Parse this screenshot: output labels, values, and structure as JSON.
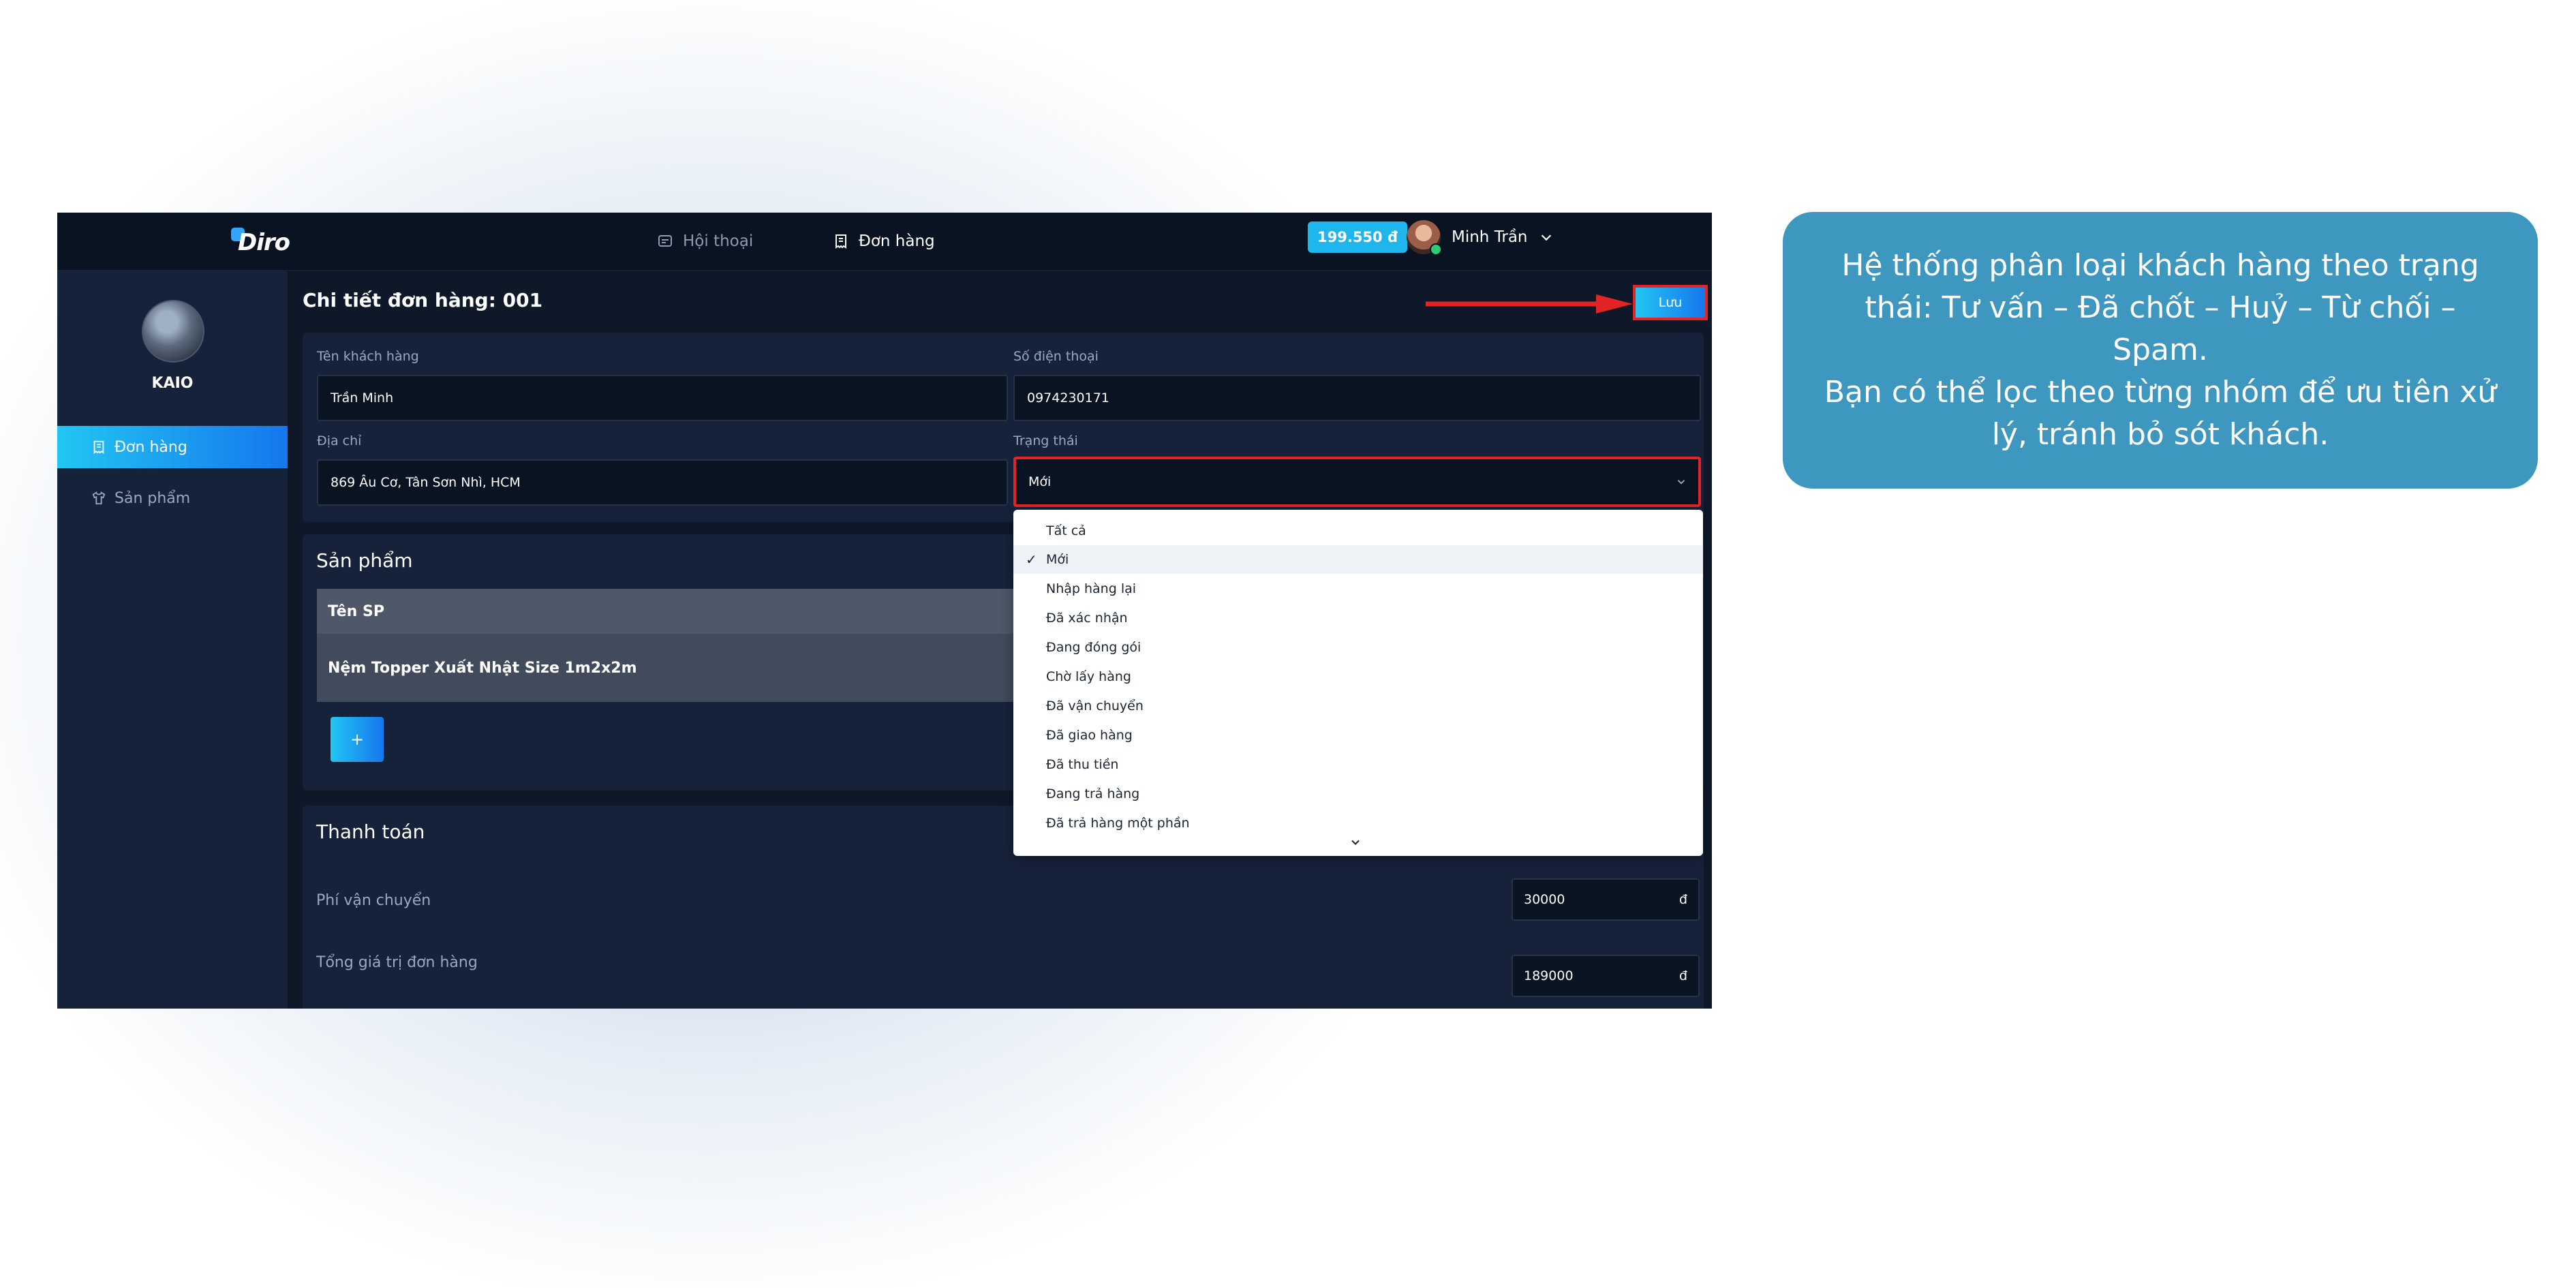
{
  "header": {
    "logo_text": "Diro",
    "nav": [
      {
        "label": "Hội thoại",
        "icon": "chat-icon"
      },
      {
        "label": "Đơn hàng",
        "icon": "receipt-icon"
      }
    ],
    "balance": "199.550 đ",
    "user_name": "Minh Trần"
  },
  "sidebar": {
    "shop_name": "KAIO",
    "items": [
      {
        "label": "Đơn hàng",
        "icon": "receipt-icon",
        "active": true
      },
      {
        "label": "Sản phẩm",
        "icon": "shirt-icon",
        "active": false
      }
    ]
  },
  "page": {
    "title": "Chi tiết đơn hàng: 001",
    "save_label": "Lưu"
  },
  "customer": {
    "name_label": "Tên khách hàng",
    "name_value": "Trần Minh",
    "phone_label": "Số điện thoại",
    "phone_value": "0974230171",
    "address_label": "Địa chỉ",
    "address_value": "869 Âu Cơ, Tân Sơn Nhì, HCM",
    "status_label": "Trạng thái",
    "status_value": "Mới"
  },
  "products": {
    "title": "Sản phẩm",
    "column_name": "Tên SP",
    "rows": [
      {
        "name": "Nệm Topper Xuất Nhật Size 1m2x2m"
      }
    ],
    "add_label": "+"
  },
  "payment": {
    "title": "Thanh toán",
    "shipping_label": "Phí vận chuyển",
    "shipping_value": "30000",
    "total_label": "Tổng giá trị đơn hàng",
    "total_value": "189000",
    "currency": "đ"
  },
  "status_dropdown": {
    "selected": "Mới",
    "options": [
      "Tất cả",
      "Mới",
      "Nhập hàng lại",
      "Đã xác nhận",
      "Đang đóng gói",
      "Chờ lấy hàng",
      "Đã vận chuyển",
      "Đã giao hàng",
      "Đã thu tiền",
      "Đang trả hàng",
      "Đã trả hàng một phần"
    ]
  },
  "callout": {
    "line1": "Hệ thống phân loại khách hàng theo trạng thái: Tư vấn  – Đã chốt – Huỷ – Từ chối – Spam.",
    "line2": "Bạn có thể lọc theo từng nhóm để ưu tiên xử lý, tránh bỏ sót khách."
  },
  "colors": {
    "accent": "#1fb6ee",
    "highlight": "#e32424",
    "callout_bg": "#3d97bf",
    "app_bg": "#0e1829"
  }
}
